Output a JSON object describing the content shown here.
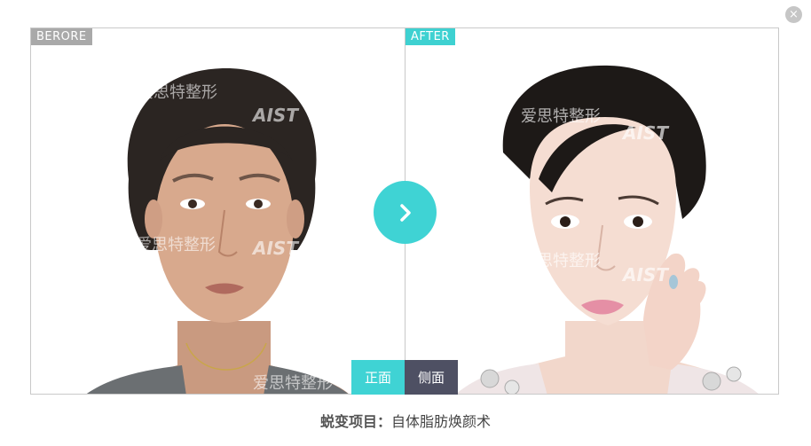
{
  "close_icon": "×",
  "before_panel": {
    "tag": "BERORE"
  },
  "after_panel": {
    "tag": "AFTER"
  },
  "watermark": {
    "brand_cn": "爱思特整形",
    "brand_en": "AIST"
  },
  "view_tabs": [
    {
      "label": "正面",
      "active": true
    },
    {
      "label": "侧面",
      "active": false
    }
  ],
  "caption": {
    "label": "蜕变项目：",
    "value": "自体脂肪焕颜术"
  },
  "colors": {
    "accent": "#3fd3d4",
    "dark_tab": "#4e5063",
    "before_tag": "#a9a9a9"
  }
}
